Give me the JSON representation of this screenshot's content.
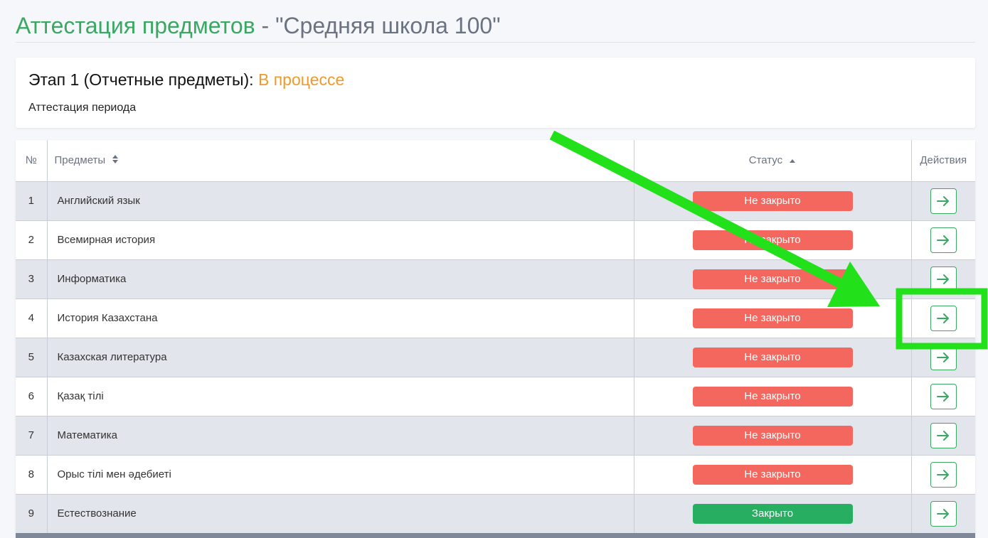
{
  "header": {
    "title_main": "Аттестация предметов",
    "title_sub": " - \"Средняя школа 100\""
  },
  "stage": {
    "title": "Этап 1 (Отчетные предметы): ",
    "status": "В процессе",
    "subtitle": "Аттестация периода"
  },
  "table": {
    "columns": [
      "№",
      "Предметы",
      "Статус",
      "Действия"
    ],
    "rows": [
      {
        "num": "1",
        "subject": "Английский язык",
        "status": "Не закрыто",
        "closed": false
      },
      {
        "num": "2",
        "subject": "Всемирная история",
        "status": "Не закрыто",
        "closed": false
      },
      {
        "num": "3",
        "subject": "Информатика",
        "status": "Не закрыто",
        "closed": false
      },
      {
        "num": "4",
        "subject": "История Казахстана",
        "status": "Не закрыто",
        "closed": false
      },
      {
        "num": "5",
        "subject": "Казахская литература",
        "status": "Не закрыто",
        "closed": false
      },
      {
        "num": "6",
        "subject": "Қазақ тілі",
        "status": "Не закрыто",
        "closed": false
      },
      {
        "num": "7",
        "subject": "Математика",
        "status": "Не закрыто",
        "closed": false
      },
      {
        "num": "8",
        "subject": "Орыс тілі мен әдебиеті",
        "status": "Не закрыто",
        "closed": false
      },
      {
        "num": "9",
        "subject": "Естествознание",
        "status": "Закрыто",
        "closed": true
      }
    ],
    "action_icon": "arrow-right-icon",
    "sort_icons": {
      "subject": "sort-both-icon",
      "status": "sort-up-icon"
    }
  },
  "colors": {
    "accent": "#3aa862",
    "status_open": "#f4675f",
    "status_closed": "#27ae60",
    "stage_status": "#ef9a2c",
    "annotation": "#22e01a"
  }
}
